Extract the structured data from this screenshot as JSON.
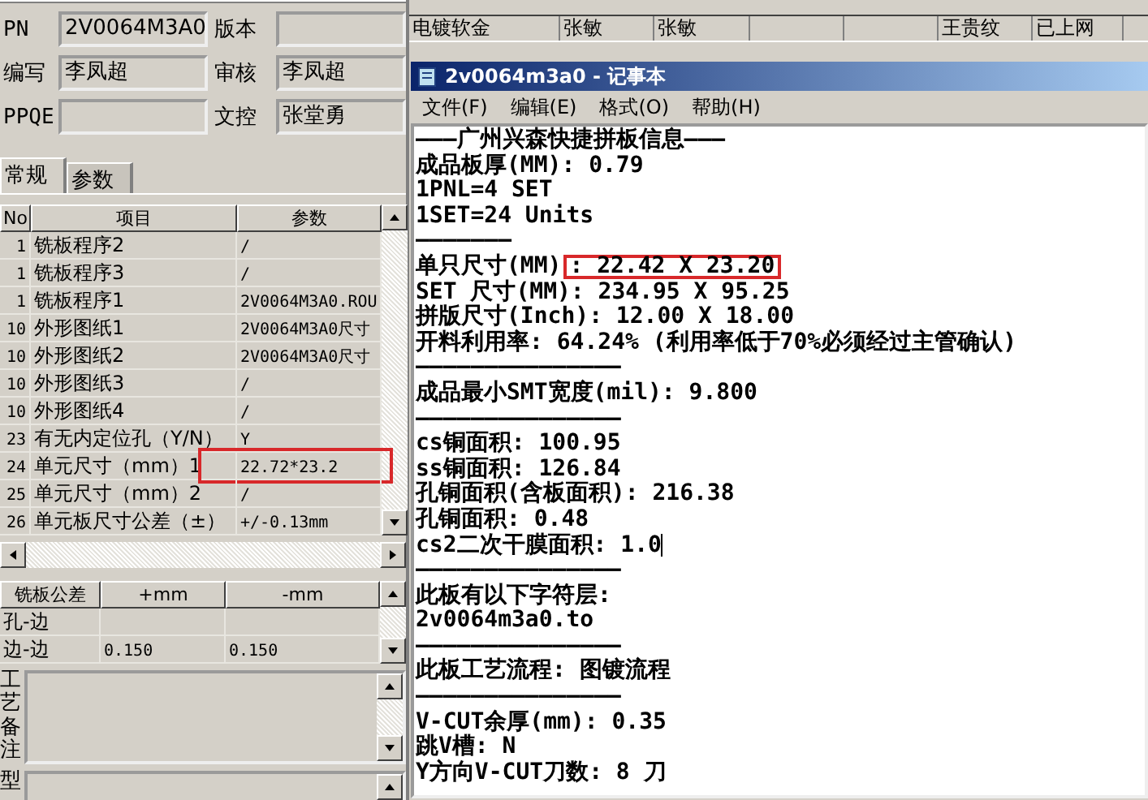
{
  "background_table": {
    "rows": [
      {
        "cells": [
          "电镀软金",
          "张敏",
          "张敏",
          "",
          "",
          "王贵纹",
          "已上网"
        ]
      }
    ]
  },
  "left_panel": {
    "form": [
      {
        "label": "PN",
        "value": "2V0064M3A0"
      },
      {
        "label": "版本"
      },
      {
        "label": "编写",
        "value": "李凤超"
      },
      {
        "label": "审核",
        "value": "李凤超"
      },
      {
        "label": "PPQE"
      },
      {
        "label": "文控",
        "value": "张堂勇"
      }
    ],
    "tabs": [
      {
        "label": "常规",
        "selected": true
      },
      {
        "label": "参数",
        "selected": false
      }
    ],
    "param_table": {
      "columns": [
        "No",
        "项目",
        "参数"
      ],
      "rows": [
        {
          "no": "1",
          "item": "铣板程序2",
          "value": "/",
          "highlighted": false
        },
        {
          "no": "1",
          "item": "铣板程序3",
          "value": "/",
          "highlighted": false
        },
        {
          "no": "1",
          "item": "铣板程序1",
          "value": "2V0064M3A0.ROU",
          "highlighted": false
        },
        {
          "no": "10",
          "item": "外形图纸1",
          "value": "2V0064M3A0尺寸",
          "highlighted": false
        },
        {
          "no": "10",
          "item": "外形图纸2",
          "value": "2V0064M3A0尺寸",
          "highlighted": false
        },
        {
          "no": "10",
          "item": "外形图纸3",
          "value": "/",
          "highlighted": false
        },
        {
          "no": "10",
          "item": "外形图纸4",
          "value": "/",
          "highlighted": false
        },
        {
          "no": "23",
          "item": "有无内定位孔（Y/N）",
          "value": "Y",
          "highlighted": false
        },
        {
          "no": "24",
          "item": "单元尺寸（mm）1",
          "value": "22.72*23.2",
          "highlighted": true
        },
        {
          "no": "25",
          "item": "单元尺寸（mm）2",
          "value": "/",
          "highlighted": false
        },
        {
          "no": "26",
          "item": "单元板尺寸公差（±）",
          "value": "+/-0.13mm",
          "highlighted": false
        }
      ]
    },
    "tolerance_table": {
      "columns": [
        "铣板公差",
        "+mm",
        "-mm"
      ],
      "rows": [
        {
          "cells": [
            "孔-边",
            "",
            ""
          ]
        },
        {
          "cells": [
            "边-边",
            "0.150",
            "0.150"
          ]
        }
      ]
    },
    "memos": [
      {
        "label": "工艺备注"
      },
      {
        "label": "型"
      }
    ]
  },
  "notepad": {
    "title": "2v0064m3a0 - 记事本",
    "menu": [
      "文件(F)",
      "编辑(E)",
      "格式(O)",
      "帮助(H)"
    ],
    "lines": [
      {
        "text": "———广州兴森快捷拼板信息———"
      },
      {
        "text": "成品板厚(MM): 0.79"
      },
      {
        "text": "1PNL=4 SET"
      },
      {
        "text": "1SET=24 Units"
      },
      {
        "text": "———————"
      },
      {
        "text": "单只尺寸(MM)",
        "highlight": ": 22.42 X 23.20"
      },
      {
        "text": "SET 尺寸(MM): 234.95 X 95.25"
      },
      {
        "text": "拼版尺寸(Inch): 12.00 X 18.00"
      },
      {
        "text": "开料利用率: 64.24% (利用率低于70%必须经过主管确认)"
      },
      {
        "text": "———————————————"
      },
      {
        "text": "成品最小SMT宽度(mil): 9.800"
      },
      {
        "text": "———————————————"
      },
      {
        "text": "cs铜面积: 100.95"
      },
      {
        "text": "ss铜面积: 126.84"
      },
      {
        "text": "孔铜面积(含板面积): 216.38"
      },
      {
        "text": "孔铜面积: 0.48"
      },
      {
        "text": "cs2二次干膜面积: 1.0",
        "cursor": true
      },
      {
        "text": "———————————————"
      },
      {
        "text": "此板有以下字符层:"
      },
      {
        "text": "2v0064m3a0.to"
      },
      {
        "text": "———————————————"
      },
      {
        "text": "此板工艺流程: 图镀流程"
      },
      {
        "text": "———————————————"
      },
      {
        "text": "V-CUT余厚(mm): 0.35"
      },
      {
        "text": "跳V槽: N"
      },
      {
        "text": "Y方向V-CUT刀数: 8 刀"
      }
    ]
  }
}
